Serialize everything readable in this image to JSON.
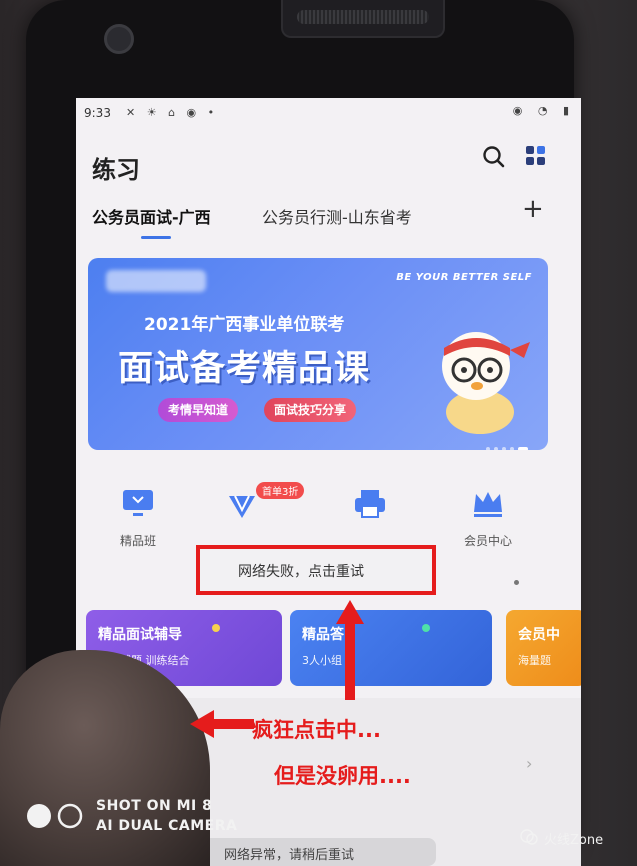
{
  "status_bar": {
    "time": "9:33",
    "left_icons": "✕ ☀ ⌂ ◉ •",
    "right_icons": "◉ ◔ ▮"
  },
  "header": {
    "title": "练习"
  },
  "tabs": [
    {
      "label": "公务员面试-广西",
      "active": true
    },
    {
      "label": "公务员行测-山东省考",
      "active": false
    }
  ],
  "tab_add": "+",
  "banner": {
    "slogan": "BE YOUR BETTER SELF",
    "subtitle": "2021年广西事业单位联考",
    "title": "面试备考精品课",
    "tags": [
      "考情早知道",
      "面试技巧分享"
    ]
  },
  "quick_nav": {
    "badge": "首单3折",
    "items": [
      {
        "label": "精品班",
        "icon": "monitor-icon"
      },
      {
        "label": "",
        "icon": "diamond-icon"
      },
      {
        "label": "",
        "icon": "printer-icon"
      },
      {
        "label": "会员中心",
        "icon": "crown-icon"
      }
    ]
  },
  "error_toast": "网络失败，点击重试",
  "cards": [
    {
      "title": "精品面试辅导",
      "subtitle": "精选试题 训练结合",
      "color": "#7c52e0"
    },
    {
      "title": "精品答",
      "subtitle": "3人小组",
      "color": "#4476ea"
    },
    {
      "title": "会员中",
      "subtitle": "海量题",
      "color": "#f29b24"
    }
  ],
  "bottom_toast": "网络异常，请稍后重试",
  "annotations": {
    "line1": "疯狂点击中...",
    "line2": "但是没卵用...."
  },
  "watermark": {
    "line1": "SHOT ON MI 8",
    "line2": "AI DUAL CAMERA"
  },
  "credit": "火线Zone",
  "colors": {
    "accent": "#3d73e6",
    "annotation_red": "#e51c1c"
  }
}
